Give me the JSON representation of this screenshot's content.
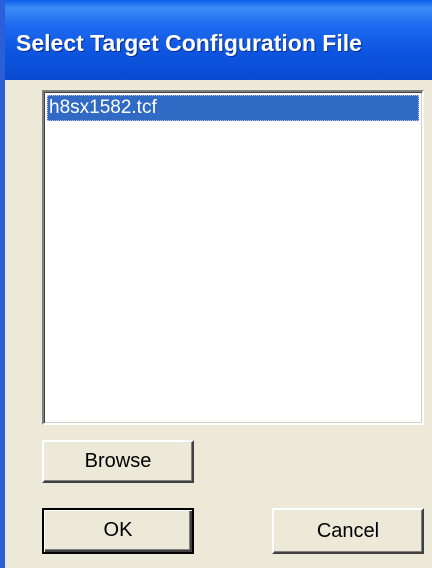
{
  "dialog": {
    "title": "Select Target Configuration File"
  },
  "file_list": {
    "items": [
      "h8sx1582.tcf"
    ],
    "selected_index": 0
  },
  "buttons": {
    "browse_label": "Browse",
    "ok_label": "OK",
    "cancel_label": "Cancel"
  },
  "colors": {
    "titlebar": "#0a4bd0",
    "dialog_background": "#ece9d8",
    "selection": "#316ac5"
  }
}
